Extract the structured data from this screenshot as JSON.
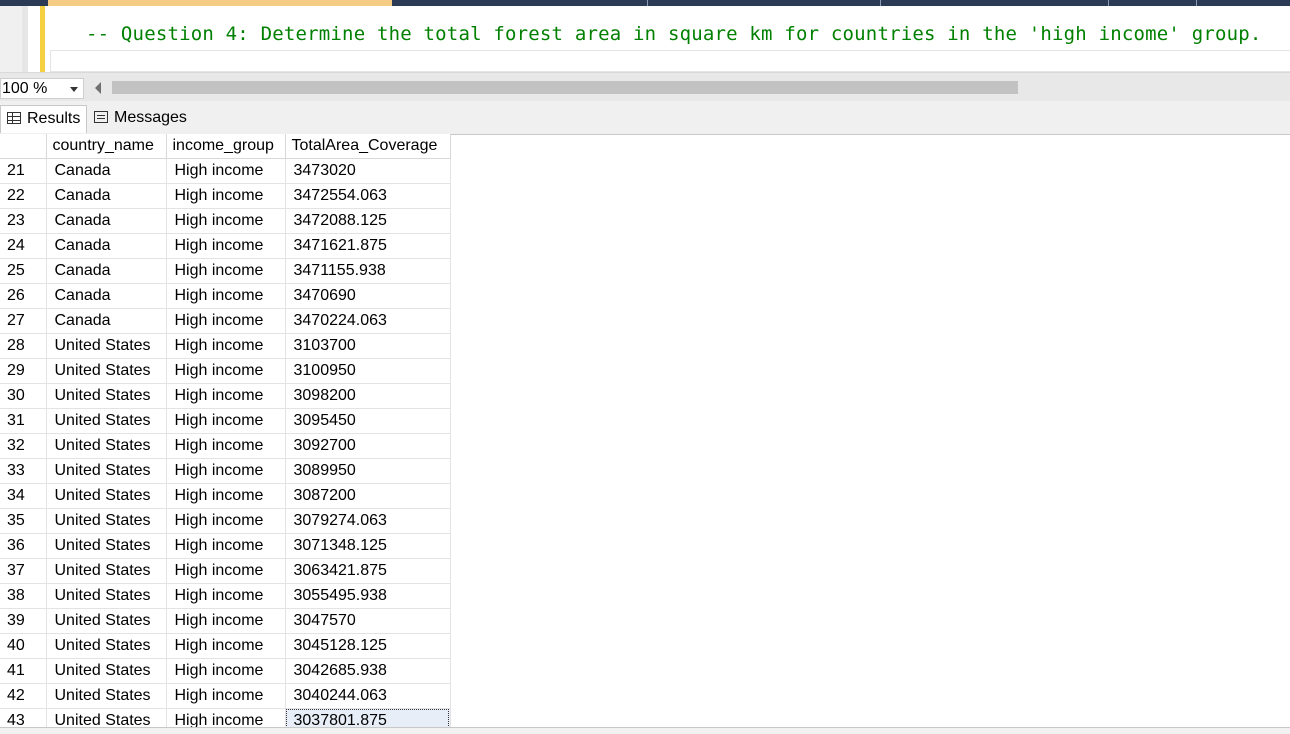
{
  "editor": {
    "code_line": "-- Question 4: Determine the total forest area in square km for countries in the 'high income' group."
  },
  "zoom": {
    "value": "100 %"
  },
  "tabs": {
    "results": "Results",
    "messages": "Messages"
  },
  "grid": {
    "columns": [
      "",
      "country_name",
      "income_group",
      "TotalArea_Coverage"
    ],
    "rows": [
      [
        "21",
        "Canada",
        "High income",
        "3473020"
      ],
      [
        "22",
        "Canada",
        "High income",
        "3472554.063"
      ],
      [
        "23",
        "Canada",
        "High income",
        "3472088.125"
      ],
      [
        "24",
        "Canada",
        "High income",
        "3471621.875"
      ],
      [
        "25",
        "Canada",
        "High income",
        "3471155.938"
      ],
      [
        "26",
        "Canada",
        "High income",
        "3470690"
      ],
      [
        "27",
        "Canada",
        "High income",
        "3470224.063"
      ],
      [
        "28",
        "United States",
        "High income",
        "3103700"
      ],
      [
        "29",
        "United States",
        "High income",
        "3100950"
      ],
      [
        "30",
        "United States",
        "High income",
        "3098200"
      ],
      [
        "31",
        "United States",
        "High income",
        "3095450"
      ],
      [
        "32",
        "United States",
        "High income",
        "3092700"
      ],
      [
        "33",
        "United States",
        "High income",
        "3089950"
      ],
      [
        "34",
        "United States",
        "High income",
        "3087200"
      ],
      [
        "35",
        "United States",
        "High income",
        "3079274.063"
      ],
      [
        "36",
        "United States",
        "High income",
        "3071348.125"
      ],
      [
        "37",
        "United States",
        "High income",
        "3063421.875"
      ],
      [
        "38",
        "United States",
        "High income",
        "3055495.938"
      ],
      [
        "39",
        "United States",
        "High income",
        "3047570"
      ],
      [
        "40",
        "United States",
        "High income",
        "3045128.125"
      ],
      [
        "41",
        "United States",
        "High income",
        "3042685.938"
      ],
      [
        "42",
        "United States",
        "High income",
        "3040244.063"
      ],
      [
        "43",
        "United States",
        "High income",
        "3037801.875"
      ]
    ]
  }
}
